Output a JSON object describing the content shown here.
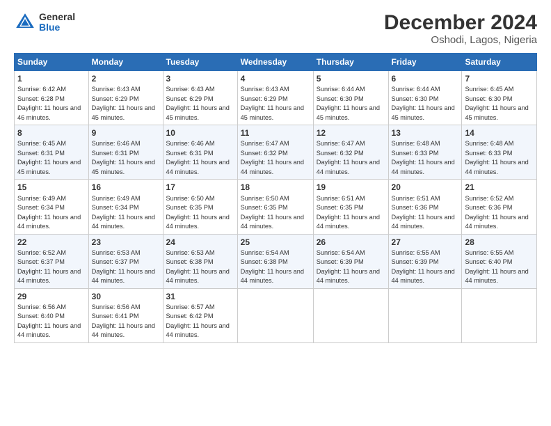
{
  "logo": {
    "general": "General",
    "blue": "Blue"
  },
  "title": "December 2024",
  "subtitle": "Oshodi, Lagos, Nigeria",
  "days_header": [
    "Sunday",
    "Monday",
    "Tuesday",
    "Wednesday",
    "Thursday",
    "Friday",
    "Saturday"
  ],
  "weeks": [
    [
      {
        "day": "1",
        "sunrise": "6:42 AM",
        "sunset": "6:28 PM",
        "daylight": "11 hours and 46 minutes."
      },
      {
        "day": "2",
        "sunrise": "6:43 AM",
        "sunset": "6:29 PM",
        "daylight": "11 hours and 45 minutes."
      },
      {
        "day": "3",
        "sunrise": "6:43 AM",
        "sunset": "6:29 PM",
        "daylight": "11 hours and 45 minutes."
      },
      {
        "day": "4",
        "sunrise": "6:43 AM",
        "sunset": "6:29 PM",
        "daylight": "11 hours and 45 minutes."
      },
      {
        "day": "5",
        "sunrise": "6:44 AM",
        "sunset": "6:30 PM",
        "daylight": "11 hours and 45 minutes."
      },
      {
        "day": "6",
        "sunrise": "6:44 AM",
        "sunset": "6:30 PM",
        "daylight": "11 hours and 45 minutes."
      },
      {
        "day": "7",
        "sunrise": "6:45 AM",
        "sunset": "6:30 PM",
        "daylight": "11 hours and 45 minutes."
      }
    ],
    [
      {
        "day": "8",
        "sunrise": "6:45 AM",
        "sunset": "6:31 PM",
        "daylight": "11 hours and 45 minutes."
      },
      {
        "day": "9",
        "sunrise": "6:46 AM",
        "sunset": "6:31 PM",
        "daylight": "11 hours and 45 minutes."
      },
      {
        "day": "10",
        "sunrise": "6:46 AM",
        "sunset": "6:31 PM",
        "daylight": "11 hours and 44 minutes."
      },
      {
        "day": "11",
        "sunrise": "6:47 AM",
        "sunset": "6:32 PM",
        "daylight": "11 hours and 44 minutes."
      },
      {
        "day": "12",
        "sunrise": "6:47 AM",
        "sunset": "6:32 PM",
        "daylight": "11 hours and 44 minutes."
      },
      {
        "day": "13",
        "sunrise": "6:48 AM",
        "sunset": "6:33 PM",
        "daylight": "11 hours and 44 minutes."
      },
      {
        "day": "14",
        "sunrise": "6:48 AM",
        "sunset": "6:33 PM",
        "daylight": "11 hours and 44 minutes."
      }
    ],
    [
      {
        "day": "15",
        "sunrise": "6:49 AM",
        "sunset": "6:34 PM",
        "daylight": "11 hours and 44 minutes."
      },
      {
        "day": "16",
        "sunrise": "6:49 AM",
        "sunset": "6:34 PM",
        "daylight": "11 hours and 44 minutes."
      },
      {
        "day": "17",
        "sunrise": "6:50 AM",
        "sunset": "6:35 PM",
        "daylight": "11 hours and 44 minutes."
      },
      {
        "day": "18",
        "sunrise": "6:50 AM",
        "sunset": "6:35 PM",
        "daylight": "11 hours and 44 minutes."
      },
      {
        "day": "19",
        "sunrise": "6:51 AM",
        "sunset": "6:35 PM",
        "daylight": "11 hours and 44 minutes."
      },
      {
        "day": "20",
        "sunrise": "6:51 AM",
        "sunset": "6:36 PM",
        "daylight": "11 hours and 44 minutes."
      },
      {
        "day": "21",
        "sunrise": "6:52 AM",
        "sunset": "6:36 PM",
        "daylight": "11 hours and 44 minutes."
      }
    ],
    [
      {
        "day": "22",
        "sunrise": "6:52 AM",
        "sunset": "6:37 PM",
        "daylight": "11 hours and 44 minutes."
      },
      {
        "day": "23",
        "sunrise": "6:53 AM",
        "sunset": "6:37 PM",
        "daylight": "11 hours and 44 minutes."
      },
      {
        "day": "24",
        "sunrise": "6:53 AM",
        "sunset": "6:38 PM",
        "daylight": "11 hours and 44 minutes."
      },
      {
        "day": "25",
        "sunrise": "6:54 AM",
        "sunset": "6:38 PM",
        "daylight": "11 hours and 44 minutes."
      },
      {
        "day": "26",
        "sunrise": "6:54 AM",
        "sunset": "6:39 PM",
        "daylight": "11 hours and 44 minutes."
      },
      {
        "day": "27",
        "sunrise": "6:55 AM",
        "sunset": "6:39 PM",
        "daylight": "11 hours and 44 minutes."
      },
      {
        "day": "28",
        "sunrise": "6:55 AM",
        "sunset": "6:40 PM",
        "daylight": "11 hours and 44 minutes."
      }
    ],
    [
      {
        "day": "29",
        "sunrise": "6:56 AM",
        "sunset": "6:40 PM",
        "daylight": "11 hours and 44 minutes."
      },
      {
        "day": "30",
        "sunrise": "6:56 AM",
        "sunset": "6:41 PM",
        "daylight": "11 hours and 44 minutes."
      },
      {
        "day": "31",
        "sunrise": "6:57 AM",
        "sunset": "6:42 PM",
        "daylight": "11 hours and 44 minutes."
      },
      null,
      null,
      null,
      null
    ]
  ]
}
